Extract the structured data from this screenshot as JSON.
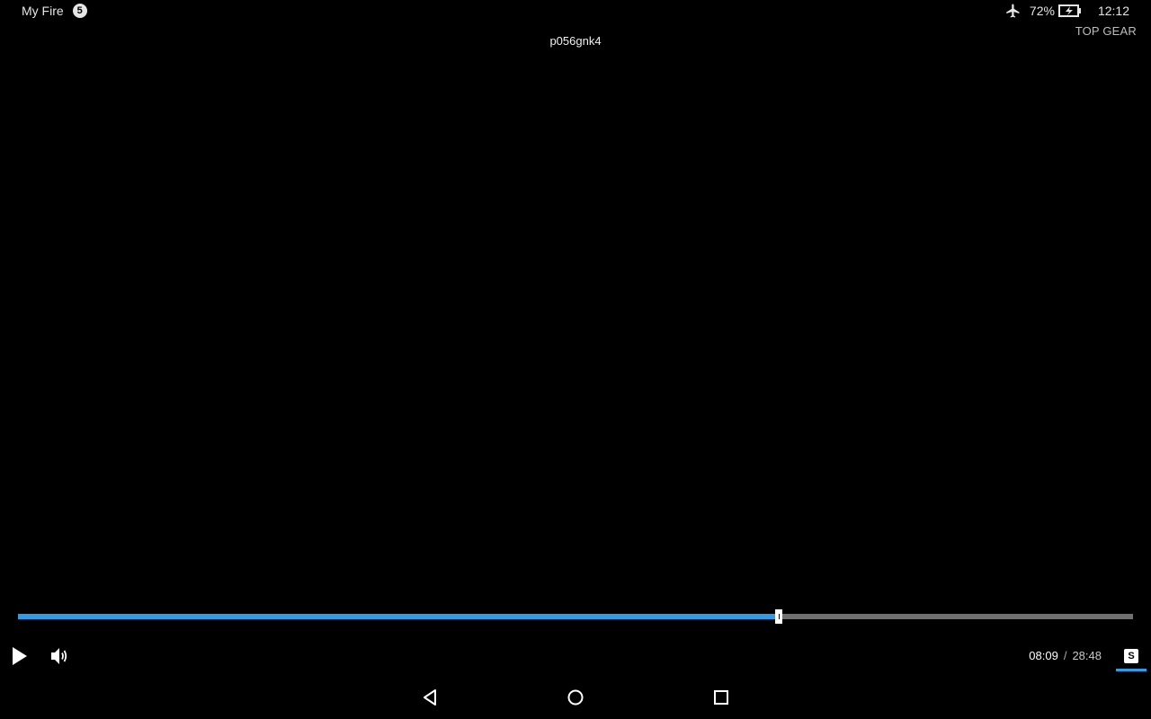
{
  "status_bar": {
    "app_name": "My Fire",
    "notification_count": "5",
    "battery_percent": "72%",
    "time": "12:12",
    "icons": [
      "airplane-mode-icon",
      "battery-charging-icon"
    ]
  },
  "channel": {
    "label": "TOP GEAR"
  },
  "video": {
    "title": "p056gnk4"
  },
  "playback": {
    "current_time": "08:09",
    "separator": "/",
    "total_time": "28:48",
    "progress": 0.682,
    "subtitle_label": "S",
    "state": "paused"
  },
  "colors": {
    "accent": "#2f9ce6",
    "track": "#707070",
    "background": "#000000"
  },
  "nav_bar": {
    "icons": [
      "back-icon",
      "home-icon",
      "recent-apps-icon"
    ]
  }
}
